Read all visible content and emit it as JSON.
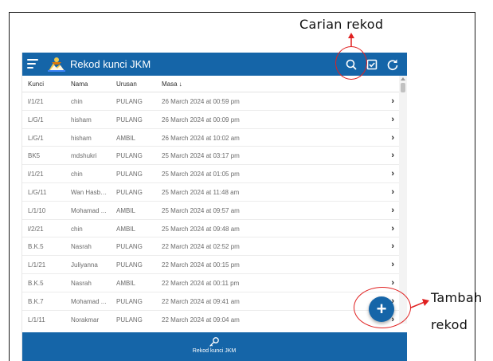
{
  "annotations": {
    "search": "Carian rekod",
    "add_line1": "Tambah",
    "add_line2": "rekod",
    "ring_color": "#e02020"
  },
  "appbar": {
    "title": "Rekod kunci JKM",
    "color": "#1565a8",
    "icons": [
      "menu-icon",
      "search-icon",
      "checkbox-icon",
      "refresh-icon"
    ]
  },
  "table": {
    "headers": {
      "kunci": "Kunci",
      "nama": "Nama",
      "urusan": "Urusan",
      "masa": "Masa",
      "sort_arrow": "↓"
    },
    "rows": [
      {
        "kunci": "l/1/21",
        "nama": "chin",
        "urusan": "PULANG",
        "masa": "26 March 2024 at 00:59 pm"
      },
      {
        "kunci": "L/G/1",
        "nama": "hisham",
        "urusan": "PULANG",
        "masa": "26 March 2024 at 00:09 pm"
      },
      {
        "kunci": "L/G/1",
        "nama": "hisham",
        "urusan": "AMBIL",
        "masa": "26 March 2024 at 10:02 am"
      },
      {
        "kunci": "BK5",
        "nama": "mdshukri",
        "urusan": "PULANG",
        "masa": "25 March 2024 at 03:17 pm"
      },
      {
        "kunci": "l/1/21",
        "nama": "chin",
        "urusan": "PULANG",
        "masa": "25 March 2024 at 01:05 pm"
      },
      {
        "kunci": "L/G/11",
        "nama": "Wan Hasbu...",
        "urusan": "PULANG",
        "masa": "25 March 2024 at 11:48 am"
      },
      {
        "kunci": "L/1/10",
        "nama": "Mohamad ...",
        "urusan": "AMBIL",
        "masa": "25 March 2024 at 09:57 am"
      },
      {
        "kunci": "l/2/21",
        "nama": "chin",
        "urusan": "AMBIL",
        "masa": "25 March 2024 at 09:48 am"
      },
      {
        "kunci": "B.K.5",
        "nama": "Nasrah",
        "urusan": "PULANG",
        "masa": "22 March 2024 at 02:52 pm"
      },
      {
        "kunci": "L/1/21",
        "nama": "Juliyanna",
        "urusan": "PULANG",
        "masa": "22 March 2024 at 00:15 pm"
      },
      {
        "kunci": "B.K.5",
        "nama": "Nasrah",
        "urusan": "AMBIL",
        "masa": "22 March 2024 at 00:11 pm"
      },
      {
        "kunci": "B.K.7",
        "nama": "Mohamad ...",
        "urusan": "PULANG",
        "masa": "22 March 2024 at 09:41 am"
      },
      {
        "kunci": "L/1/11",
        "nama": "Norakmar",
        "urusan": "PULANG",
        "masa": "22 March 2024 at 09:04 am"
      }
    ],
    "row_chevron": "›"
  },
  "bottom_nav": {
    "label": "Rekod kunci JKM",
    "icon": "key-icon"
  },
  "fab": {
    "icon": "plus-icon",
    "symbol": "+"
  }
}
